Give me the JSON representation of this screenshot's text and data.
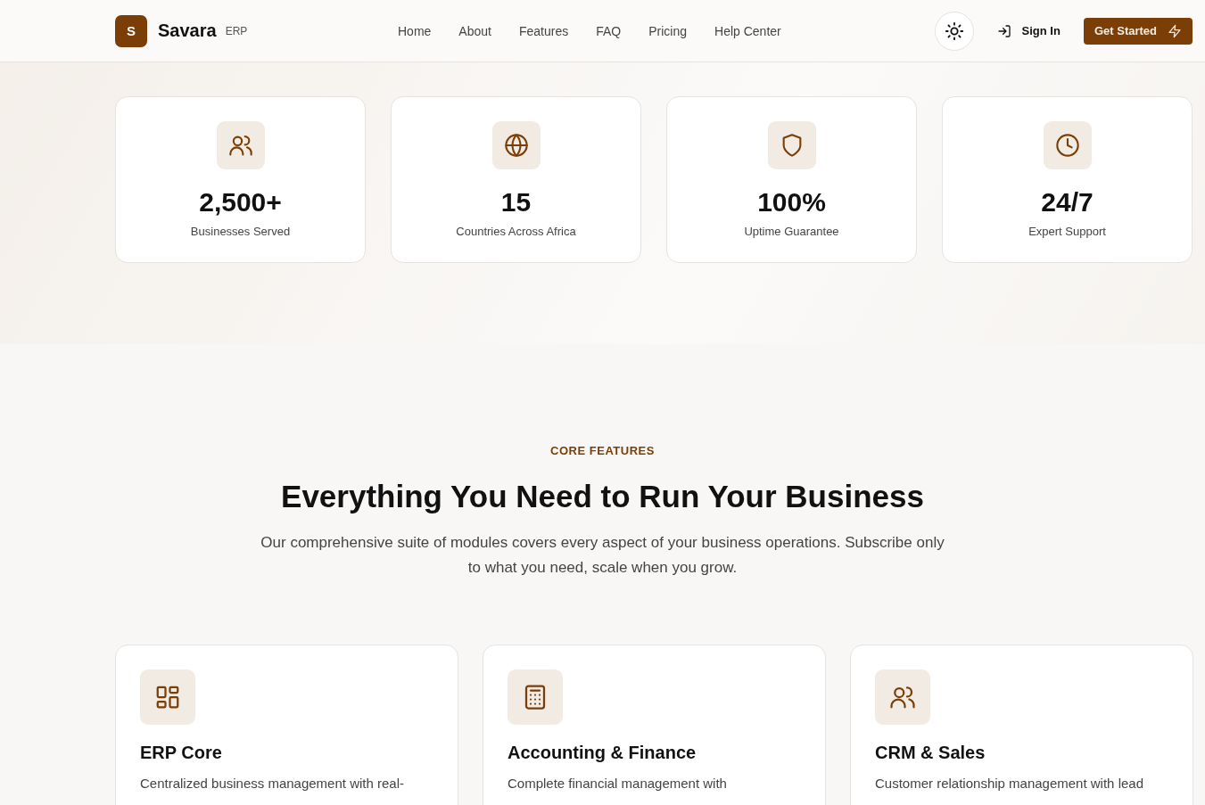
{
  "header": {
    "logo_letter": "S",
    "brand": "Savara",
    "brand_tag": "ERP",
    "nav": [
      {
        "label": "Home"
      },
      {
        "label": "About"
      },
      {
        "label": "Features"
      },
      {
        "label": "FAQ"
      },
      {
        "label": "Pricing"
      },
      {
        "label": "Help Center"
      }
    ],
    "sign_in": "Sign In",
    "cta": "Get Started"
  },
  "stats": [
    {
      "kind": "users",
      "value": "2,500+",
      "label": "Businesses Served"
    },
    {
      "kind": "globe",
      "value": "15",
      "label": "Countries Across Africa"
    },
    {
      "kind": "shield",
      "value": "100%",
      "label": "Uptime Guarantee"
    },
    {
      "kind": "clock",
      "value": "24/7",
      "label": "Expert Support"
    }
  ],
  "features": {
    "eyebrow": "CORE FEATURES",
    "title": "Everything You Need to Run Your Business",
    "subtitle": "Our comprehensive suite of modules covers every aspect of your business operations. Subscribe only to what you need, scale when you grow.",
    "cards": [
      {
        "kind": "grid",
        "title": "ERP Core",
        "description": "Centralized business management with real-"
      },
      {
        "kind": "calculator",
        "title": "Accounting & Finance",
        "description": "Complete financial management with"
      },
      {
        "kind": "users",
        "title": "CRM & Sales",
        "description": "Customer relationship management with lead"
      }
    ]
  }
}
